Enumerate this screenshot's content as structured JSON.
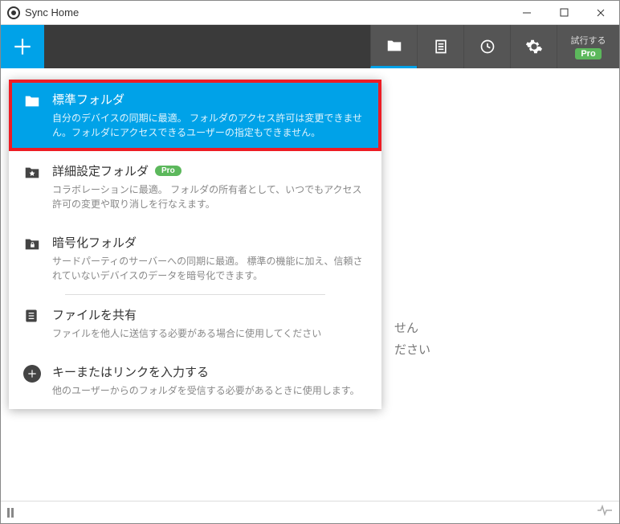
{
  "titlebar": {
    "title": "Sync Home"
  },
  "toolbar": {
    "trial": "試行する",
    "pro": "Pro"
  },
  "menu": {
    "standard": {
      "title": "標準フォルダ",
      "desc": "自分のデバイスの同期に最適。\nフォルダのアクセス許可は変更できません。フォルダにアクセスできるユーザーの指定もできません。"
    },
    "advanced": {
      "title": "詳細設定フォルダ",
      "badge": "Pro",
      "desc": "コラボレーションに最適。\nフォルダの所有者として、いつでもアクセス許可の変更や取り消しを行なえます。"
    },
    "encrypted": {
      "title": "暗号化フォルダ",
      "desc": "サードパーティのサーバーへの同期に最適。\n標準の機能に加え、信頼されていないデバイスのデータを暗号化できます。"
    },
    "share": {
      "title": "ファイルを共有",
      "desc": "ファイルを他人に送信する必要がある場合に使用してください"
    },
    "enterkey": {
      "title": "キーまたはリンクを入力する",
      "desc": "他のユーザーからのフォルダを受信する必要があるときに使用します。"
    }
  },
  "background": {
    "line1": "せん",
    "line2": "ださい"
  }
}
